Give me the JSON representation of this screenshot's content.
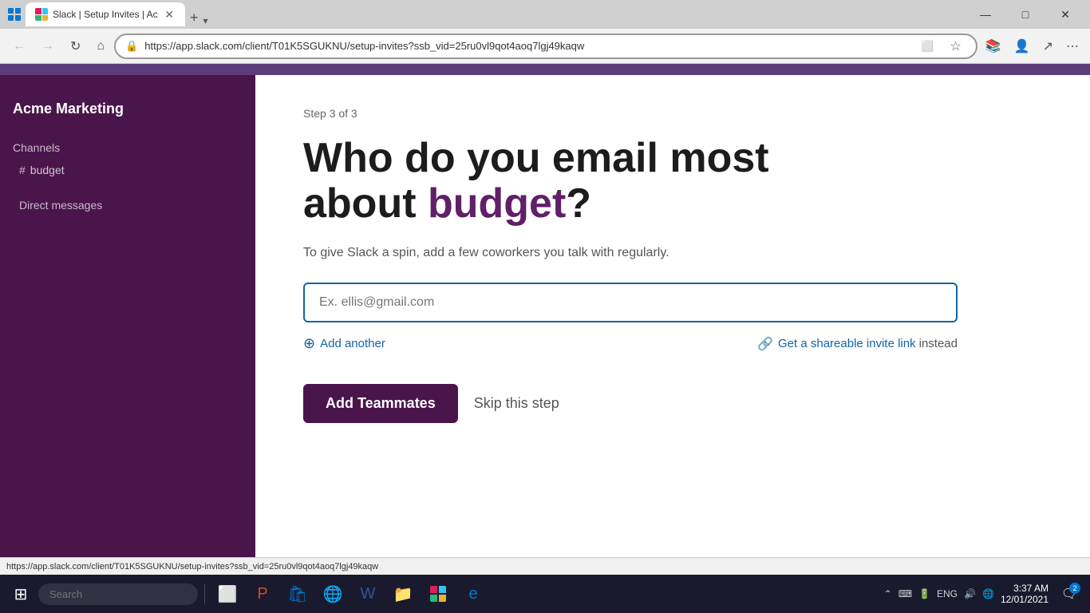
{
  "browser": {
    "tab_title": "Slack | Setup Invites | Ac",
    "url": "https://app.slack.com/client/T01K5SGUKNU/setup-invites?ssb_vid=25ru0vl9qot4aoq7lgj49kaqw",
    "status_url": "https://app.slack.com/client/T01K5SGUKNU/setup-invites?ssb_vid=25ru0vl9qot4aoq7lgj49kaqw",
    "back_btn": "←",
    "forward_btn": "→",
    "refresh_btn": "↻",
    "home_btn": "⌂",
    "minimize_btn": "—",
    "maximize_btn": "□",
    "close_btn": "✕",
    "new_tab_btn": "+",
    "menu_btn": "⋯"
  },
  "sidebar": {
    "workspace_name": "Acme Marketing",
    "channels_label": "Channels",
    "channel_name": "budget",
    "dm_label": "Direct messages"
  },
  "page": {
    "step_indicator": "Step 3 of 3",
    "title_part1": "Who do you email most",
    "title_part2": "about ",
    "title_highlight": "budget",
    "title_part3": "?",
    "subtitle": "To give Slack a spin, add a few coworkers you talk with regularly.",
    "email_placeholder": "Ex. ellis@gmail.com",
    "add_another_label": "Add another",
    "invite_link_label": "Get a shareable invite link",
    "invite_link_suffix": " instead",
    "add_teammates_btn": "Add Teammates",
    "skip_step_btn": "Skip this step"
  },
  "taskbar": {
    "time": "3:37 AM",
    "date": "12/01/2021",
    "language": "ENG",
    "notification_count": "2"
  }
}
